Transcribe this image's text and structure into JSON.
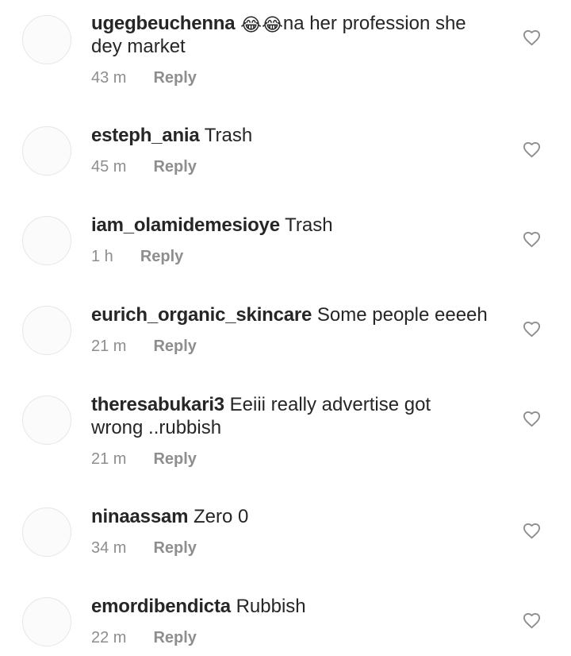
{
  "comments": [
    {
      "username": "ugegbeuchenna",
      "emoji": "😂😂",
      "text": "na her profession she dey market",
      "time": "43 m",
      "reply_label": "Reply"
    },
    {
      "username": "esteph_ania",
      "emoji": "",
      "text": "Trash",
      "time": "45 m",
      "reply_label": "Reply"
    },
    {
      "username": "iam_olamidemesioye",
      "emoji": "",
      "text": "Trash",
      "time": "1 h",
      "reply_label": "Reply"
    },
    {
      "username": "eurich_organic_skincare",
      "emoji": "",
      "text": "Some people eeeeh",
      "time": "21 m",
      "reply_label": "Reply"
    },
    {
      "username": "theresabukari3",
      "emoji": "",
      "text": "Eeiii really advertise got wrong ..rubbish",
      "time": "21 m",
      "reply_label": "Reply"
    },
    {
      "username": "ninaassam",
      "emoji": "",
      "text": "Zero 0",
      "time": "34 m",
      "reply_label": "Reply"
    },
    {
      "username": "emordibendicta",
      "emoji": "",
      "text": "Rubbish",
      "time": "22 m",
      "reply_label": "Reply"
    }
  ],
  "icons": {
    "like": "heart-outline-icon"
  },
  "colors": {
    "text": "#262626",
    "meta": "#8e8e8e",
    "avatar_placeholder": "#fbfbfb"
  }
}
